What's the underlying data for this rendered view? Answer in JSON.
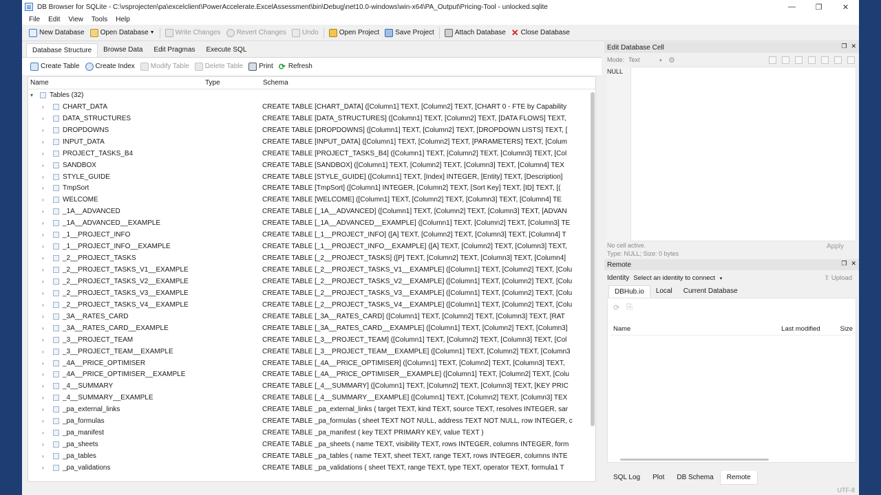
{
  "window": {
    "title": "DB Browser for SQLite - C:\\vsprojecten\\pa\\excelclient\\PowerAccelerate.ExcelAssessment\\bin\\Debug\\net10.0-windows\\win-x64\\PA_Output\\Pricing-Tool - unlocked.sqlite",
    "minimize": "—",
    "maximize": "❐",
    "close": "✕"
  },
  "menu": [
    "File",
    "Edit",
    "View",
    "Tools",
    "Help"
  ],
  "toolbar": {
    "new_database": "New Database",
    "open_database": "Open Database",
    "write_changes": "Write Changes",
    "revert_changes": "Revert Changes",
    "undo": "Undo",
    "open_project": "Open Project",
    "save_project": "Save Project",
    "attach_database": "Attach Database",
    "close_database": "Close Database"
  },
  "tabs": [
    "Database Structure",
    "Browse Data",
    "Edit Pragmas",
    "Execute SQL"
  ],
  "structure_toolbar": {
    "create_table": "Create Table",
    "create_index": "Create Index",
    "modify_table": "Modify Table",
    "delete_table": "Delete Table",
    "print": "Print",
    "refresh": "Refresh"
  },
  "tree": {
    "columns": {
      "name": "Name",
      "type": "Type",
      "schema": "Schema"
    },
    "group_label": "Tables (32)",
    "rows": [
      {
        "name": "CHART_DATA",
        "schema": "CREATE TABLE [CHART_DATA] ([Column1] TEXT, [Column2] TEXT, [CHART 0 - FTE by Capability"
      },
      {
        "name": "DATA_STRUCTURES",
        "schema": "CREATE TABLE [DATA_STRUCTURES] ([Column1] TEXT, [Column2] TEXT, [DATA FLOWS] TEXT,"
      },
      {
        "name": "DROPDOWNS",
        "schema": "CREATE TABLE [DROPDOWNS] ([Column1] TEXT, [Column2] TEXT, [DROPDOWN LISTS] TEXT, ["
      },
      {
        "name": "INPUT_DATA",
        "schema": "CREATE TABLE [INPUT_DATA] ([Column1] TEXT, [Column2] TEXT, [PARAMETERS] TEXT, [Colum"
      },
      {
        "name": "PROJECT_TASKS_B4",
        "schema": "CREATE TABLE [PROJECT_TASKS_B4] ([Column1] TEXT, [Column2] TEXT, [Column3] TEXT, [Col"
      },
      {
        "name": "SANDBOX",
        "schema": "CREATE TABLE [SANDBOX] ([Column1] TEXT, [Column2] TEXT, [Column3] TEXT, [Column4] TEX"
      },
      {
        "name": "STYLE_GUIDE",
        "schema": "CREATE TABLE [STYLE_GUIDE] ([Column1] TEXT, [Index] INTEGER, [Entity] TEXT, [Description]"
      },
      {
        "name": "TmpSort",
        "schema": "CREATE TABLE [TmpSort] ([Column1] INTEGER, [Column2] TEXT, [Sort Key] TEXT, [ID] TEXT, [("
      },
      {
        "name": "WELCOME",
        "schema": "CREATE TABLE [WELCOME] ([Column1] TEXT, [Column2] TEXT, [Column3] TEXT, [Column4] TE"
      },
      {
        "name": "_1A__ADVANCED",
        "schema": "CREATE TABLE [_1A__ADVANCED] ([Column1] TEXT, [Column2] TEXT, [Column3] TEXT, [ADVAN"
      },
      {
        "name": "_1A__ADVANCED__EXAMPLE",
        "schema": "CREATE TABLE [_1A__ADVANCED__EXAMPLE] ([Column1] TEXT, [Column2] TEXT, [Column3] TE"
      },
      {
        "name": "_1__PROJECT_INFO",
        "schema": "CREATE TABLE [_1__PROJECT_INFO] ([A] TEXT, [Column2] TEXT, [Column3] TEXT, [Column4] T"
      },
      {
        "name": "_1__PROJECT_INFO__EXAMPLE",
        "schema": "CREATE TABLE [_1__PROJECT_INFO__EXAMPLE] ([A] TEXT, [Column2] TEXT, [Column3] TEXT,"
      },
      {
        "name": "_2__PROJECT_TASKS",
        "schema": "CREATE TABLE [_2__PROJECT_TASKS] ([P] TEXT, [Column2] TEXT, [Column3] TEXT, [Column4]"
      },
      {
        "name": "_2__PROJECT_TASKS_V1__EXAMPLE",
        "schema": "CREATE TABLE [_2__PROJECT_TASKS_V1__EXAMPLE] ([Column1] TEXT, [Column2] TEXT, [Colu"
      },
      {
        "name": "_2__PROJECT_TASKS_V2__EXAMPLE",
        "schema": "CREATE TABLE [_2__PROJECT_TASKS_V2__EXAMPLE] ([Column1] TEXT, [Column2] TEXT, [Colu"
      },
      {
        "name": "_2__PROJECT_TASKS_V3__EXAMPLE",
        "schema": "CREATE TABLE [_2__PROJECT_TASKS_V3__EXAMPLE] ([Column1] TEXT, [Column2] TEXT, [Colu"
      },
      {
        "name": "_2__PROJECT_TASKS_V4__EXAMPLE",
        "schema": "CREATE TABLE [_2__PROJECT_TASKS_V4__EXAMPLE] ([Column1] TEXT, [Column2] TEXT, [Colu"
      },
      {
        "name": "_3A__RATES_CARD",
        "schema": "CREATE TABLE [_3A__RATES_CARD] ([Column1] TEXT, [Column2] TEXT, [Column3] TEXT, [RAT"
      },
      {
        "name": "_3A__RATES_CARD__EXAMPLE",
        "schema": "CREATE TABLE [_3A__RATES_CARD__EXAMPLE] ([Column1] TEXT, [Column2] TEXT, [Column3]"
      },
      {
        "name": "_3__PROJECT_TEAM",
        "schema": "CREATE TABLE [_3__PROJECT_TEAM] ([Column1] TEXT, [Column2] TEXT, [Column3] TEXT, [Col"
      },
      {
        "name": "_3__PROJECT_TEAM__EXAMPLE",
        "schema": "CREATE TABLE [_3__PROJECT_TEAM__EXAMPLE] ([Column1] TEXT, [Column2] TEXT, [Column3"
      },
      {
        "name": "_4A__PRICE_OPTIMISER",
        "schema": "CREATE TABLE [_4A__PRICE_OPTIMISER] ([Column1] TEXT, [Column2] TEXT, [Column3] TEXT,"
      },
      {
        "name": "_4A__PRICE_OPTIMISER__EXAMPLE",
        "schema": "CREATE TABLE [_4A__PRICE_OPTIMISER__EXAMPLE] ([Column1] TEXT, [Column2] TEXT, [Colu"
      },
      {
        "name": "_4__SUMMARY",
        "schema": "CREATE TABLE [_4__SUMMARY] ([Column1] TEXT, [Column2] TEXT, [Column3] TEXT, [KEY PRIC"
      },
      {
        "name": "_4__SUMMARY__EXAMPLE",
        "schema": "CREATE TABLE [_4__SUMMARY__EXAMPLE] ([Column1] TEXT, [Column2] TEXT, [Column3] TEX"
      },
      {
        "name": "_pa_external_links",
        "schema": "CREATE TABLE _pa_external_links ( target TEXT, kind TEXT, source TEXT, resolves INTEGER, sar"
      },
      {
        "name": "_pa_formulas",
        "schema": "CREATE TABLE _pa_formulas ( sheet TEXT NOT NULL, address TEXT NOT NULL, row INTEGER, c"
      },
      {
        "name": "_pa_manifest",
        "schema": "CREATE TABLE _pa_manifest ( key TEXT PRIMARY KEY, value TEXT )"
      },
      {
        "name": "_pa_sheets",
        "schema": "CREATE TABLE _pa_sheets ( name TEXT, visibility TEXT, rows INTEGER, columns INTEGER, form"
      },
      {
        "name": "_pa_tables",
        "schema": "CREATE TABLE _pa_tables ( name TEXT, sheet TEXT, range TEXT, rows INTEGER, columns INTE"
      },
      {
        "name": "_pa_validations",
        "schema": "CREATE TABLE _pa_validations ( sheet TEXT, range TEXT, type TEXT, operator TEXT, formula1 T"
      }
    ]
  },
  "edit_cell": {
    "title": "Edit Database Cell",
    "mode_label": "Mode:",
    "mode_value": "Text",
    "value": "NULL",
    "status_line1": "No cell active.",
    "status_line2": "Type: NULL; Size: 0 bytes",
    "apply": "Apply"
  },
  "remote": {
    "title": "Remote",
    "identity_label": "Identity",
    "identity_value": "Select an identity to connect",
    "upload": "Upload",
    "tabs": [
      "DBHub.io",
      "Local",
      "Current Database"
    ],
    "columns": {
      "name": "Name",
      "last_modified": "Last modified",
      "size": "Size"
    }
  },
  "bottom_tabs": [
    "SQL Log",
    "Plot",
    "DB Schema",
    "Remote"
  ],
  "status": {
    "encoding": "UTF-8"
  }
}
